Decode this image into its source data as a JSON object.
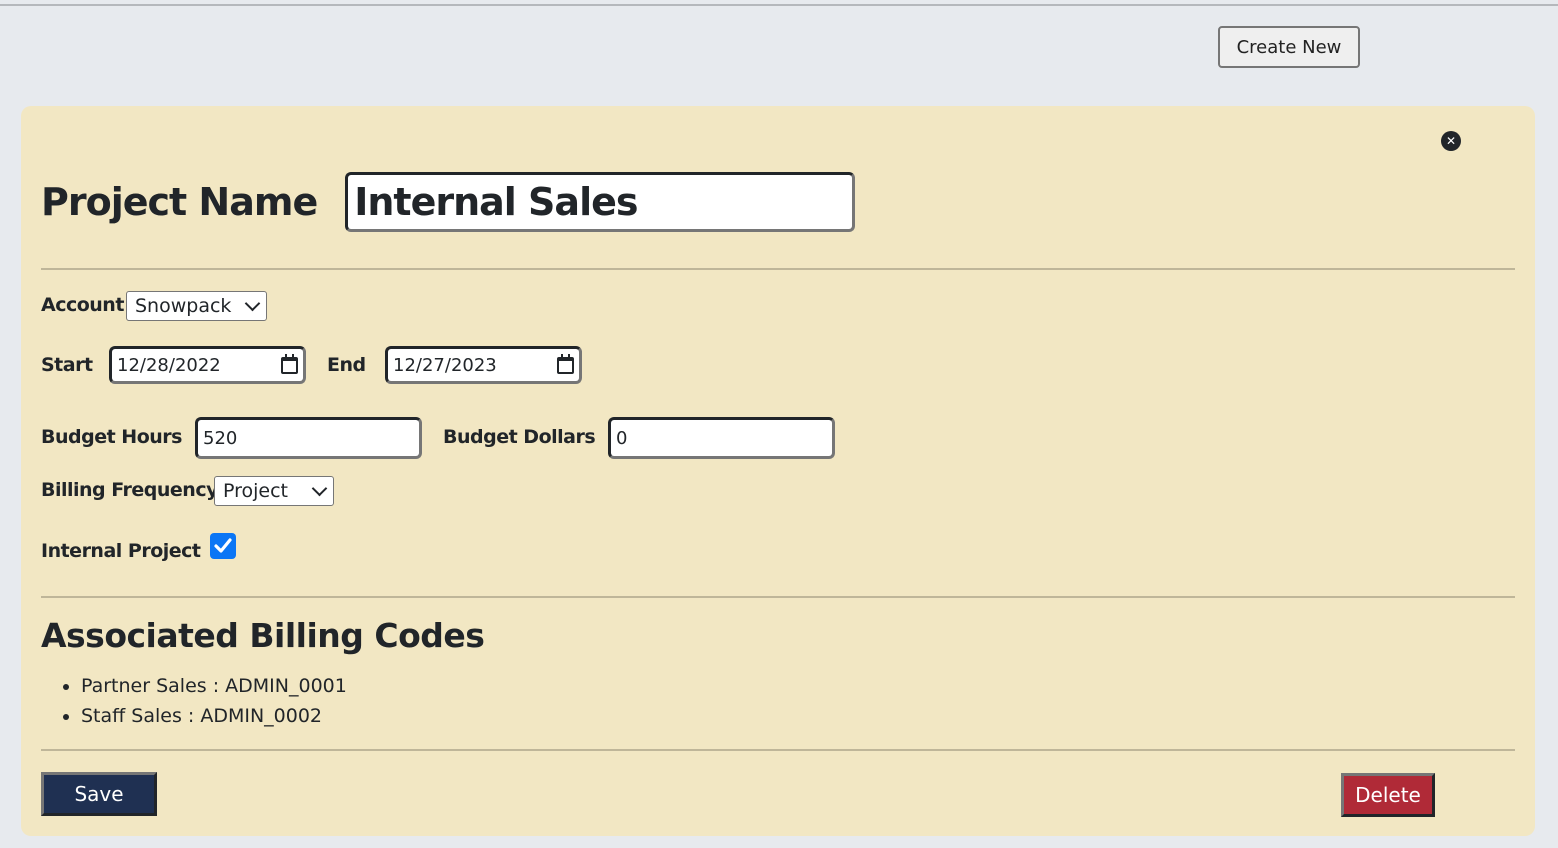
{
  "header": {
    "create_new_label": "Create New"
  },
  "panel": {
    "close_icon": "close-icon",
    "title_label": "Project Name",
    "project_name_value": "Internal Sales",
    "account": {
      "label": "Account",
      "selected": "Snowpack"
    },
    "start": {
      "label": "Start",
      "value": "12/28/2022"
    },
    "end": {
      "label": "End",
      "value": "12/27/2023"
    },
    "budget_hours": {
      "label": "Budget Hours",
      "value": "520"
    },
    "budget_dollars": {
      "label": "Budget Dollars",
      "value": "0"
    },
    "billing_frequency": {
      "label": "Billing Frequency",
      "selected": "Project"
    },
    "internal_project": {
      "label": "Internal Project",
      "checked": true
    },
    "billing_codes": {
      "heading": "Associated Billing Codes",
      "items": [
        "Partner Sales : ADMIN_0001",
        "Staff Sales : ADMIN_0002"
      ]
    },
    "save_label": "Save",
    "delete_label": "Delete"
  },
  "colors": {
    "page_bg": "#e7eaee",
    "panel_bg": "#f2e7c3",
    "save_bg": "#1f3052",
    "delete_bg": "#b02a37",
    "checkbox": "#0b76f5"
  }
}
